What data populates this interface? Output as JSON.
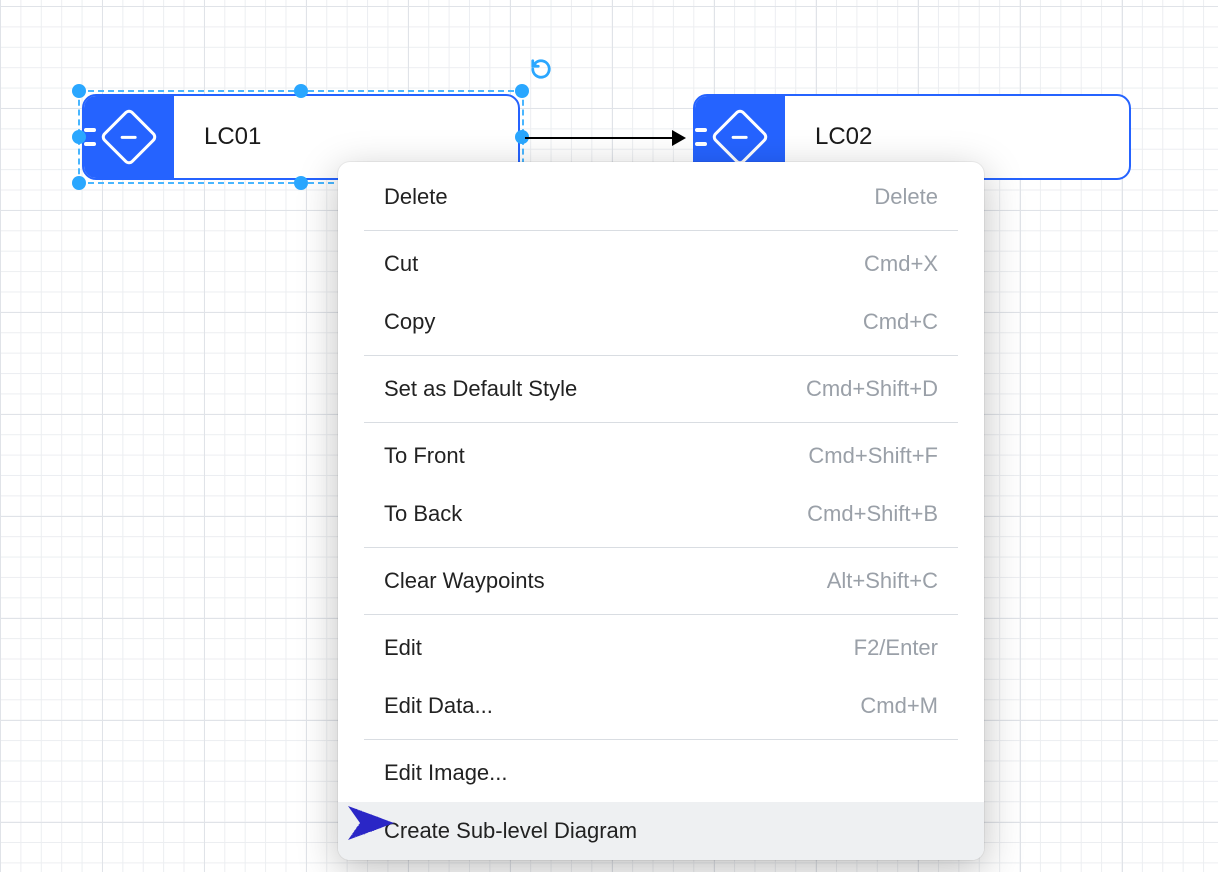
{
  "nodes": {
    "a": {
      "label": "LC01"
    },
    "b": {
      "label": "LC02"
    }
  },
  "context_menu": {
    "groups": [
      [
        {
          "label": "Delete",
          "shortcut": "Delete"
        }
      ],
      [
        {
          "label": "Cut",
          "shortcut": "Cmd+X"
        },
        {
          "label": "Copy",
          "shortcut": "Cmd+C"
        }
      ],
      [
        {
          "label": "Set as Default Style",
          "shortcut": "Cmd+Shift+D"
        }
      ],
      [
        {
          "label": "To Front",
          "shortcut": "Cmd+Shift+F"
        },
        {
          "label": "To Back",
          "shortcut": "Cmd+Shift+B"
        }
      ],
      [
        {
          "label": "Clear Waypoints",
          "shortcut": "Alt+Shift+C"
        }
      ],
      [
        {
          "label": "Edit",
          "shortcut": "F2/Enter"
        },
        {
          "label": "Edit Data...",
          "shortcut": "Cmd+M"
        }
      ],
      [
        {
          "label": "Edit Image...",
          "shortcut": ""
        },
        {
          "label": "Create Sub-level Diagram",
          "shortcut": "",
          "highlight": true
        }
      ]
    ]
  },
  "colors": {
    "accent": "#2563ff",
    "selection": "#2aa7ff",
    "annotation": "#2b27c6"
  }
}
